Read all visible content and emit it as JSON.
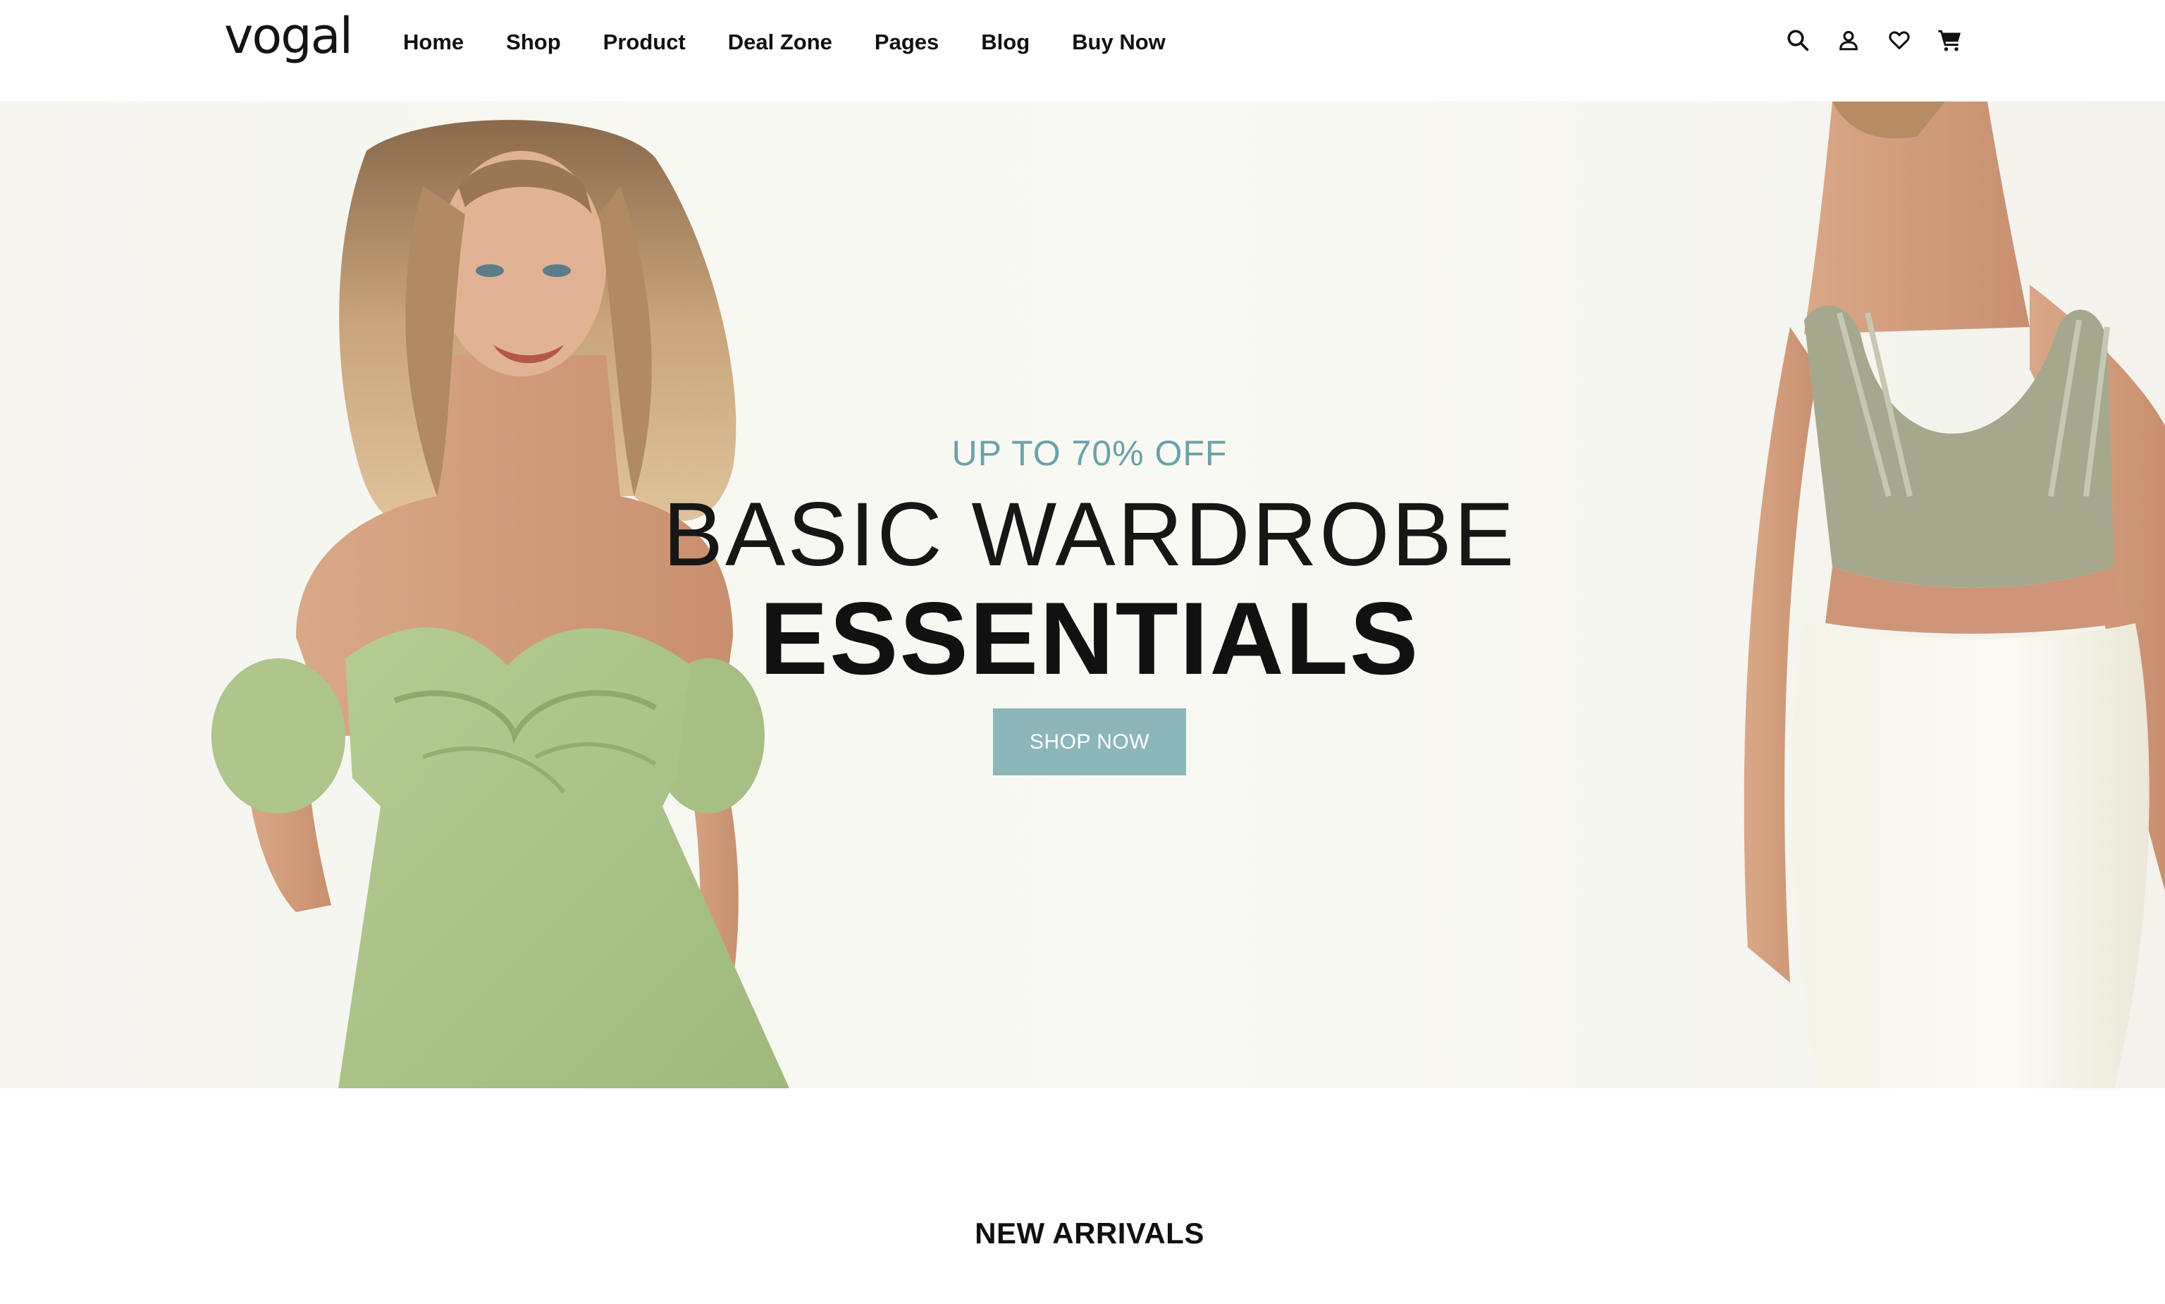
{
  "brand": {
    "logo_text": "vogal"
  },
  "nav": {
    "items": [
      {
        "label": "Home"
      },
      {
        "label": "Shop"
      },
      {
        "label": "Product"
      },
      {
        "label": "Deal Zone"
      },
      {
        "label": "Pages"
      },
      {
        "label": "Blog"
      },
      {
        "label": "Buy Now"
      }
    ]
  },
  "header_icons": [
    "search-icon",
    "user-icon",
    "heart-icon",
    "cart-icon"
  ],
  "hero": {
    "promo": "UP TO 70% OFF",
    "title_line1": "BASIC WARDROBE",
    "title_line2": "ESSENTIALS",
    "cta_label": "SHOP NOW"
  },
  "sections": {
    "new_arrivals_title": "NEW ARRIVALS"
  },
  "colors": {
    "accent": "#6aa2aa",
    "button": "#8cb6ba",
    "text": "#111111",
    "hero_bg": "#f8f8f2"
  }
}
